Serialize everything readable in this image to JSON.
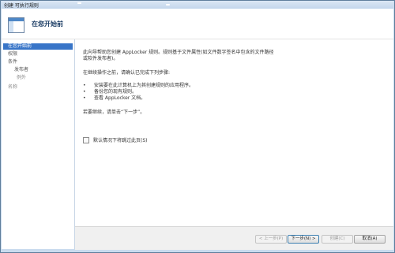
{
  "window": {
    "title": "创建 可执行规则"
  },
  "header": {
    "heading": "在您开始前"
  },
  "sidebar": {
    "items": [
      {
        "label": "在您开始前"
      },
      {
        "label": "权限"
      },
      {
        "label": "条件"
      },
      {
        "label": "发布者"
      },
      {
        "label": "例外"
      },
      {
        "label": "名称"
      }
    ]
  },
  "content": {
    "intro_line1": "此向导帮助您创建 AppLocker 规则。规则基于文件属性(如文件数字签名中包含的文件路径",
    "intro_line2": "或软件发布者)。",
    "prereq": "在继续操作之前，请确认已完成下列步骤:",
    "bullets": [
      "安装要在此计算机上为其创建规则的应用程序。",
      "备份您的现有规则。",
      "查看 AppLocker 文档。"
    ],
    "continue_text": "若要继续，请单击“下一步”。",
    "skip_checkbox_label": "默认情况下将跳过此页(S)",
    "skip_checked": false
  },
  "footer": {
    "prev_label": "< 上一步(P)",
    "next_label": "下一步(N) >",
    "create_label": "创建(C)",
    "cancel_label": "取消(A)"
  },
  "colors": {
    "active_nav": "#3875c8",
    "heading": "#1e3f66",
    "frame": "#c9dbee"
  }
}
